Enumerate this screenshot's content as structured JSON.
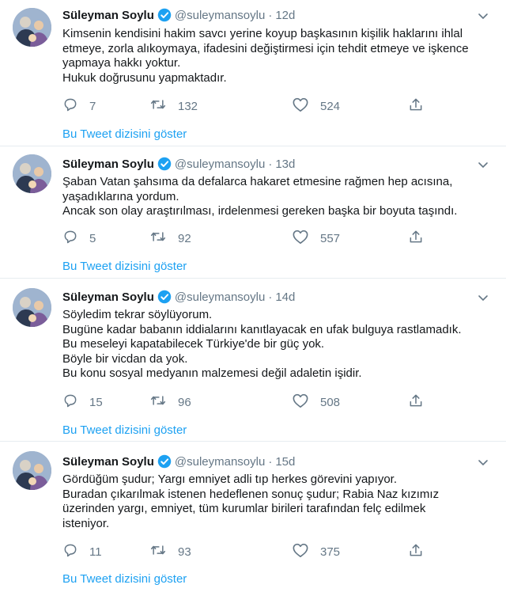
{
  "tweets": [
    {
      "name": "Süleyman Soylu",
      "handle": "@suleymansoylu",
      "dot": "·",
      "time": "12d",
      "lines": [
        "Kimsenin kendisini hakim savcı yerine koyup başkasının kişilik haklarını ihlal",
        "etmeye, zorla alıkoymaya, ifadesini değiştirmesi için tehdit etmeye ve işkence",
        "yapmaya hakkı yoktur.",
        "Hukuk doğrusunu yapmaktadır."
      ],
      "replies": "7",
      "retweets": "132",
      "likes": "524",
      "thread_label": "Bu Tweet dizisini göster"
    },
    {
      "name": "Süleyman Soylu",
      "handle": "@suleymansoylu",
      "dot": "·",
      "time": "13d",
      "lines": [
        "Şaban Vatan şahsıma da defalarca hakaret etmesine rağmen hep acısına,",
        "yaşadıklarına yordum.",
        "Ancak son olay araştırılması, irdelenmesi gereken başka bir boyuta taşındı."
      ],
      "replies": "5",
      "retweets": "92",
      "likes": "557",
      "thread_label": "Bu Tweet dizisini göster"
    },
    {
      "name": "Süleyman Soylu",
      "handle": "@suleymansoylu",
      "dot": "·",
      "time": "14d",
      "lines": [
        "Söyledim tekrar söylüyorum.",
        "Bugüne kadar babanın iddialarını kanıtlayacak en ufak bulguya rastlamadık.",
        "Bu meseleyi kapatabilecek Türkiye'de bir güç yok.",
        "Böyle bir vicdan da yok.",
        "Bu konu sosyal medyanın malzemesi değil adaletin işidir."
      ],
      "replies": "15",
      "retweets": "96",
      "likes": "508",
      "thread_label": "Bu Tweet dizisini göster"
    },
    {
      "name": "Süleyman Soylu",
      "handle": "@suleymansoylu",
      "dot": "·",
      "time": "15d",
      "lines": [
        "Gördüğüm şudur; Yargı emniyet adli tıp herkes görevini yapıyor.",
        "Buradan çıkarılmak istenen hedeflenen sonuç şudur; Rabia Naz kızımız",
        "üzerinden yargı, emniyet, tüm kurumlar birileri tarafından felç edilmek",
        "isteniyor."
      ],
      "replies": "11",
      "retweets": "93",
      "likes": "375",
      "thread_label": "Bu Tweet dizisini göster"
    }
  ],
  "colors": {
    "link": "#1da1f2",
    "muted": "#657786",
    "text": "#14171a",
    "verified": "#1da1f2",
    "divider": "#e6ecf0"
  },
  "icons": {
    "reply": "reply-icon",
    "retweet": "retweet-icon",
    "like": "heart-icon",
    "share": "share-icon",
    "more": "chevron-down-icon",
    "verified": "verified-badge-icon"
  }
}
